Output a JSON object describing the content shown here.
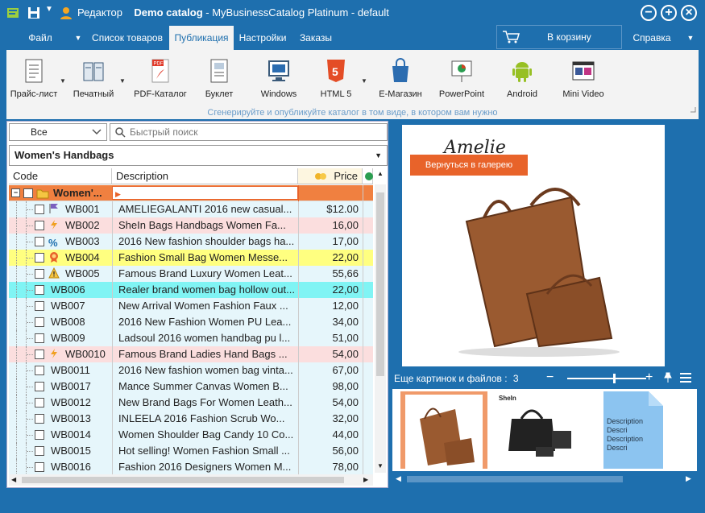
{
  "window": {
    "app_label": "Редактор",
    "title_bold": "Demo catalog",
    "title_rest": " - MyBusinessCatalog Platinum - default"
  },
  "menu": {
    "items": [
      "Файл",
      "Список товаров",
      "Публикация",
      "Настройки",
      "Заказы"
    ],
    "active": "Публикация",
    "cart": "В корзину",
    "help": "Справка"
  },
  "ribbon": {
    "buttons": [
      {
        "label": "Прайс-лист",
        "icon": "price-list-icon"
      },
      {
        "label": "Печатный",
        "icon": "print-catalog-icon"
      },
      {
        "label": "PDF-Каталог",
        "icon": "pdf-icon"
      },
      {
        "label": "Буклет",
        "icon": "booklet-icon"
      },
      {
        "label": "Windows",
        "icon": "windows-icon"
      },
      {
        "label": "HTML 5",
        "icon": "html5-icon"
      },
      {
        "label": "E-Магазин",
        "icon": "shop-bag-icon"
      },
      {
        "label": "PowerPoint",
        "icon": "powerpoint-icon"
      },
      {
        "label": "Android",
        "icon": "android-icon"
      },
      {
        "label": "Mini Video",
        "icon": "video-icon"
      }
    ],
    "pdf_badge": "PDF",
    "html_badge": "5",
    "hint": "Сгенерируйте и опубликуйте каталог в том виде, в котором вам нужно"
  },
  "filter": {
    "value": "Все"
  },
  "search": {
    "placeholder": "Быстрый поиск"
  },
  "category": "Women's Handbags",
  "grid": {
    "headers": {
      "code": "Code",
      "description": "Description",
      "price": "Price"
    },
    "group": {
      "label": "Women'..."
    },
    "rows": [
      {
        "code": "WB001",
        "desc": "AMELIEGALANTI 2016 new casual...",
        "price": "$12.00",
        "icon": "flag-icon",
        "bg": "#e6f6fb"
      },
      {
        "code": "WB002",
        "desc": "SheIn Bags Handbags Women Fa...",
        "price": "16,00",
        "icon": "lightning-icon",
        "bg": "#fbdede"
      },
      {
        "code": "WB003",
        "desc": "2016 New fashion shoulder bags ha...",
        "price": "17,00",
        "icon": "percent-icon",
        "bg": "#e6f6fb"
      },
      {
        "code": "WB004",
        "desc": "Fashion Small Bag Women Messe...",
        "price": "22,00",
        "icon": "award-icon",
        "bg": "#ffff80"
      },
      {
        "code": "WB005",
        "desc": "Famous Brand Luxury Women Leat...",
        "price": "55,66",
        "icon": "warning-icon",
        "bg": "#e6f6fb"
      },
      {
        "code": "WB006",
        "desc": "Realer brand women bag hollow out...",
        "price": "22,00",
        "icon": "",
        "bg": "#80f4f4"
      },
      {
        "code": "WB007",
        "desc": "New Arrival Women Fashion Faux ...",
        "price": "12,00",
        "icon": "",
        "bg": "#e6f6fb"
      },
      {
        "code": "WB008",
        "desc": "2016 New Fashion Women PU Lea...",
        "price": "34,00",
        "icon": "",
        "bg": "#e6f6fb"
      },
      {
        "code": "WB009",
        "desc": "Ladsoul 2016 women handbag pu l...",
        "price": "51,00",
        "icon": "",
        "bg": "#e6f6fb"
      },
      {
        "code": "WB0010",
        "desc": "Famous Brand Ladies Hand Bags ...",
        "price": "54,00",
        "icon": "lightning-icon",
        "bg": "#fbdede"
      },
      {
        "code": "WB0011",
        "desc": "2016 New fashion women bag vinta...",
        "price": "67,00",
        "icon": "",
        "bg": "#e6f6fb"
      },
      {
        "code": "WB0017",
        "desc": "Mance Summer Canvas Women B...",
        "price": "98,00",
        "icon": "",
        "bg": "#e6f6fb"
      },
      {
        "code": "WB0012",
        "desc": "New Brand Bags For Women Leath...",
        "price": "54,00",
        "icon": "",
        "bg": "#e6f6fb"
      },
      {
        "code": "WB0013",
        "desc": "INLEELA 2016 Fashion Scrub Wo...",
        "price": "32,00",
        "icon": "",
        "bg": "#e6f6fb"
      },
      {
        "code": "WB0014",
        "desc": "Women Shoulder Bag Candy 10 Co...",
        "price": "44,00",
        "icon": "",
        "bg": "#e6f6fb"
      },
      {
        "code": "WB0015",
        "desc": "Hot selling! Women Fashion Small ...",
        "price": "56,00",
        "icon": "",
        "bg": "#e6f6fb"
      },
      {
        "code": "WB0016",
        "desc": "Fashion 2016 Designers Women M...",
        "price": "78,00",
        "icon": "",
        "bg": "#e6f6fb"
      }
    ]
  },
  "preview": {
    "back_button": "Вернуться в галерею",
    "logo_text": "Amelie",
    "more_label": "Еще картинок и файлов :",
    "more_count": "3",
    "thumb_doc_text": "Description Descri Description Descri",
    "thumb_logo_2": "SheIn",
    "zoom_level": 0.6
  },
  "colors": {
    "accent": "#1e6fae",
    "orange": "#e8632a",
    "group_row": "#f08040"
  }
}
